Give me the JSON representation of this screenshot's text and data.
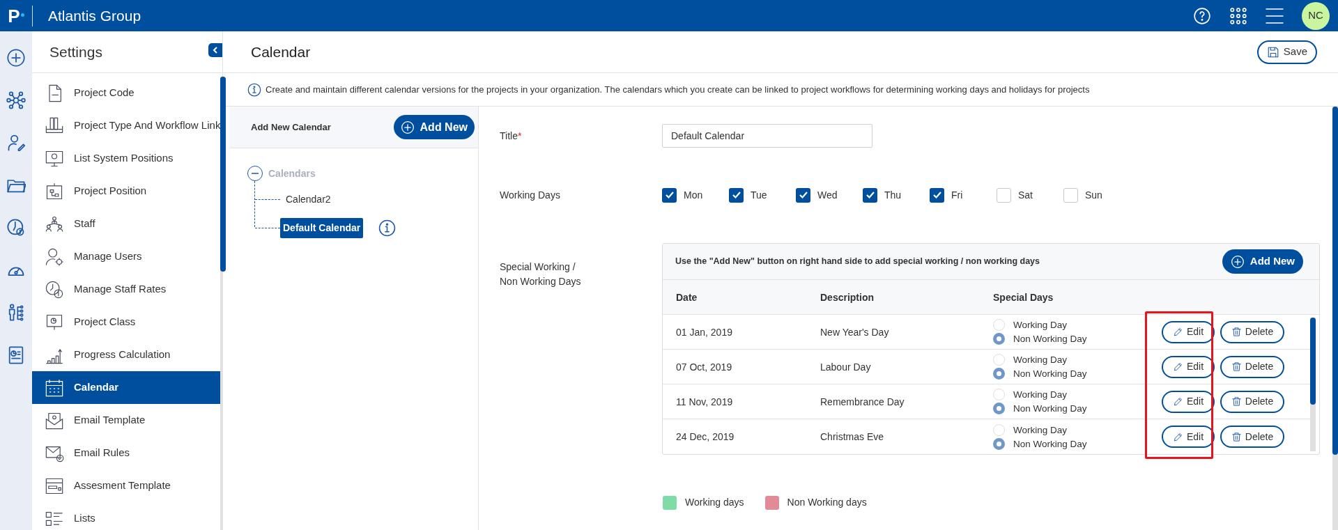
{
  "app": {
    "logo": "P",
    "title": "Atlantis Group",
    "avatar": "NC"
  },
  "sidebar": {
    "title": "Settings",
    "items": [
      {
        "label": "Project Code",
        "selected": false
      },
      {
        "label": "Project Type And Workflow Link",
        "selected": false
      },
      {
        "label": "List System Positions",
        "selected": false
      },
      {
        "label": "Project Position",
        "selected": false
      },
      {
        "label": "Staff",
        "selected": false
      },
      {
        "label": "Manage Users",
        "selected": false
      },
      {
        "label": "Manage Staff Rates",
        "selected": false
      },
      {
        "label": "Project Class",
        "selected": false
      },
      {
        "label": "Progress Calculation",
        "selected": false
      },
      {
        "label": "Calendar",
        "selected": true
      },
      {
        "label": "Email Template",
        "selected": false
      },
      {
        "label": "Email Rules",
        "selected": false
      },
      {
        "label": "Assesment Template",
        "selected": false
      },
      {
        "label": "Lists",
        "selected": false
      }
    ]
  },
  "page": {
    "title": "Calendar",
    "save_button": "Save",
    "info": "Create and maintain different calendar versions for the projects in your organization. The calendars which you create can be linked to project workflows for determining working days and holidays for projects"
  },
  "tree_panel": {
    "header": "Add New Calendar",
    "add_button": "Add New",
    "tree": [
      {
        "label": "Calendars",
        "expanded": true,
        "children": [
          {
            "label": "Calendar2",
            "selected": false
          },
          {
            "label": "Default Calendar",
            "selected": true
          }
        ]
      }
    ]
  },
  "form": {
    "title_label": "Title",
    "required_mark": "*",
    "title_value": "Default Calendar",
    "working_days_label": "Working Days",
    "days": [
      {
        "label": "Mon",
        "checked": true
      },
      {
        "label": "Tue",
        "checked": true
      },
      {
        "label": "Wed",
        "checked": true
      },
      {
        "label": "Thu",
        "checked": true
      },
      {
        "label": "Fri",
        "checked": true
      },
      {
        "label": "Sat",
        "checked": false
      },
      {
        "label": "Sun",
        "checked": false
      }
    ],
    "special_label": "Special Working / Non Working Days",
    "special_table": {
      "hint": "Use the \"Add New\" button on right hand side to add special working / non working days",
      "add_button": "Add New",
      "columns": [
        "Date",
        "Description",
        "Special Days"
      ],
      "rows": [
        {
          "date": "01 Jan, 2019",
          "description": "New Year's Day",
          "options": [
            {
              "label": "Working Day",
              "selected": false
            },
            {
              "label": "Non Working Day",
              "selected": true
            }
          ],
          "edit": "Edit",
          "delete": "Delete"
        },
        {
          "date": "07 Oct, 2019",
          "description": "Labour Day",
          "options": [
            {
              "label": "Working Day",
              "selected": false
            },
            {
              "label": "Non Working Day",
              "selected": true
            }
          ],
          "edit": "Edit",
          "delete": "Delete"
        },
        {
          "date": "11 Nov, 2019",
          "description": "Remembrance Day",
          "options": [
            {
              "label": "Working Day",
              "selected": false
            },
            {
              "label": "Non Working Day",
              "selected": true
            }
          ],
          "edit": "Edit",
          "delete": "Delete"
        },
        {
          "date": "24 Dec, 2019",
          "description": "Christmas Eve",
          "options": [
            {
              "label": "Working Day",
              "selected": false
            },
            {
              "label": "Non Working Day",
              "selected": true
            }
          ],
          "edit": "Edit",
          "delete": "Delete"
        }
      ]
    },
    "legend": [
      {
        "label": "Working days",
        "color": "#7fdba8"
      },
      {
        "label": "Non Working days",
        "color": "#e08b96"
      }
    ]
  }
}
